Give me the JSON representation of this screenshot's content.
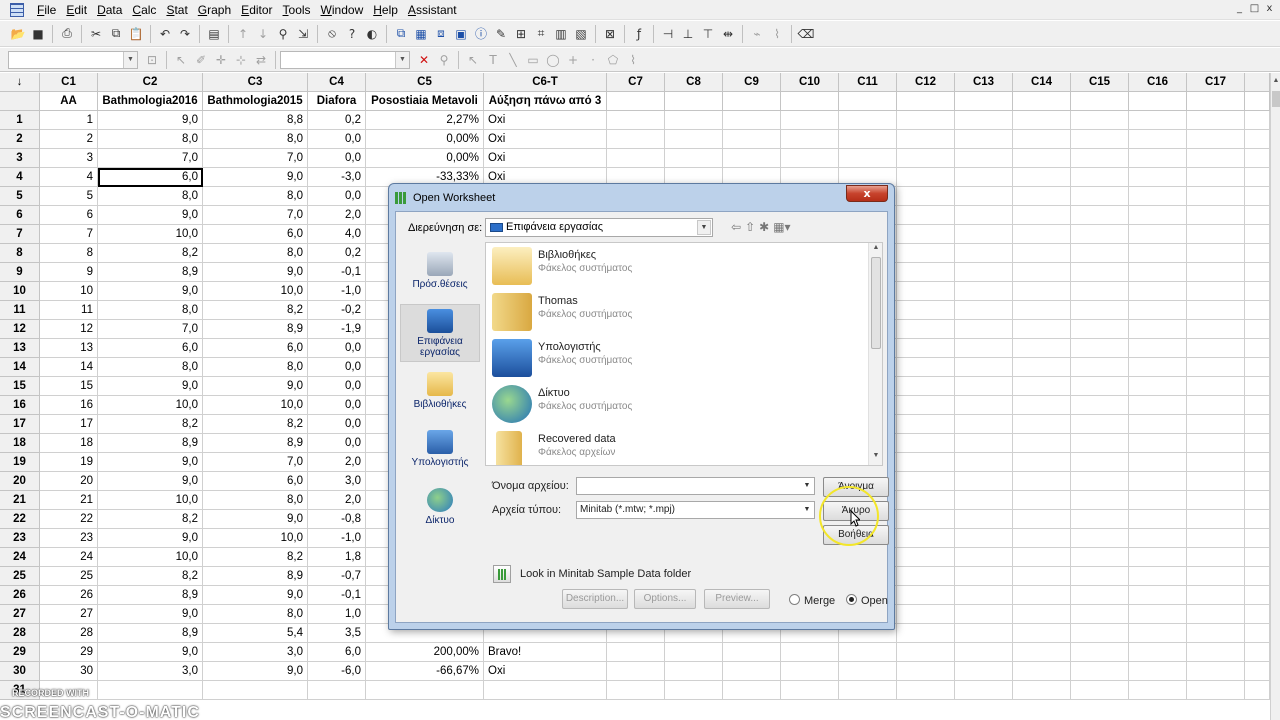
{
  "menu": [
    "File",
    "Edit",
    "Data",
    "Calc",
    "Stat",
    "Graph",
    "Editor",
    "Tools",
    "Window",
    "Help",
    "Assistant"
  ],
  "window_controls": [
    "_",
    "□",
    "x"
  ],
  "column_headers": [
    "C1",
    "C2",
    "C3",
    "C4",
    "C5",
    "C6-T",
    "C7",
    "C8",
    "C9",
    "C10",
    "C11",
    "C12",
    "C13",
    "C14",
    "C15",
    "C16",
    "C17"
  ],
  "column_names": [
    "AA",
    "Bathmologia2016",
    "Bathmologia2015",
    "Diafora",
    "Posostiaia Metavoli",
    "Αύξηση πάνω από 3",
    "",
    "",
    "",
    "",
    "",
    "",
    "",
    "",
    "",
    "",
    ""
  ],
  "corner_label": "↓",
  "rows": [
    [
      "1",
      "1",
      "9,0",
      "8,8",
      "0,2",
      "2,27%",
      "Oxi"
    ],
    [
      "2",
      "2",
      "8,0",
      "8,0",
      "0,0",
      "0,00%",
      "Oxi"
    ],
    [
      "3",
      "3",
      "7,0",
      "7,0",
      "0,0",
      "0,00%",
      "Oxi"
    ],
    [
      "4",
      "4",
      "6,0",
      "9,0",
      "-3,0",
      "-33,33%",
      "Oxi"
    ],
    [
      "5",
      "5",
      "8,0",
      "8,0",
      "0,0",
      "",
      ""
    ],
    [
      "6",
      "6",
      "9,0",
      "7,0",
      "2,0",
      "",
      ""
    ],
    [
      "7",
      "7",
      "10,0",
      "6,0",
      "4,0",
      "",
      ""
    ],
    [
      "8",
      "8",
      "8,2",
      "8,0",
      "0,2",
      "",
      ""
    ],
    [
      "9",
      "9",
      "8,9",
      "9,0",
      "-0,1",
      "",
      ""
    ],
    [
      "10",
      "10",
      "9,0",
      "10,0",
      "-1,0",
      "",
      ""
    ],
    [
      "11",
      "11",
      "8,0",
      "8,2",
      "-0,2",
      "",
      ""
    ],
    [
      "12",
      "12",
      "7,0",
      "8,9",
      "-1,9",
      "",
      ""
    ],
    [
      "13",
      "13",
      "6,0",
      "6,0",
      "0,0",
      "",
      ""
    ],
    [
      "14",
      "14",
      "8,0",
      "8,0",
      "0,0",
      "",
      ""
    ],
    [
      "15",
      "15",
      "9,0",
      "9,0",
      "0,0",
      "",
      ""
    ],
    [
      "16",
      "16",
      "10,0",
      "10,0",
      "0,0",
      "",
      ""
    ],
    [
      "17",
      "17",
      "8,2",
      "8,2",
      "0,0",
      "",
      ""
    ],
    [
      "18",
      "18",
      "8,9",
      "8,9",
      "0,0",
      "",
      ""
    ],
    [
      "19",
      "19",
      "9,0",
      "7,0",
      "2,0",
      "",
      ""
    ],
    [
      "20",
      "20",
      "9,0",
      "6,0",
      "3,0",
      "",
      ""
    ],
    [
      "21",
      "21",
      "10,0",
      "8,0",
      "2,0",
      "",
      ""
    ],
    [
      "22",
      "22",
      "8,2",
      "9,0",
      "-0,8",
      "",
      ""
    ],
    [
      "23",
      "23",
      "9,0",
      "10,0",
      "-1,0",
      "",
      ""
    ],
    [
      "24",
      "24",
      "10,0",
      "8,2",
      "1,8",
      "",
      ""
    ],
    [
      "25",
      "25",
      "8,2",
      "8,9",
      "-0,7",
      "",
      ""
    ],
    [
      "26",
      "26",
      "8,9",
      "9,0",
      "-0,1",
      "",
      ""
    ],
    [
      "27",
      "27",
      "9,0",
      "8,0",
      "1,0",
      "",
      ""
    ],
    [
      "28",
      "28",
      "8,9",
      "5,4",
      "3,5",
      "",
      ""
    ],
    [
      "29",
      "29",
      "9,0",
      "3,0",
      "6,0",
      "200,00%",
      "Bravo!"
    ],
    [
      "30",
      "30",
      "3,0",
      "9,0",
      "-6,0",
      "-66,67%",
      "Oxi"
    ],
    [
      "31",
      "",
      "",
      "",
      "",
      "",
      ""
    ]
  ],
  "dialog": {
    "title": "Open Worksheet",
    "close": "x",
    "look_in_label": "Διερεύνηση σε:",
    "look_in_value": "Επιφάνεια εργασίας",
    "places": [
      {
        "label": "Πρόσ.θέσεις"
      },
      {
        "label": "Επιφάνεια εργασίας"
      },
      {
        "label": "Βιβλιοθήκες"
      },
      {
        "label": "Υπολογιστής"
      },
      {
        "label": "Δίκτυο"
      }
    ],
    "files": [
      {
        "name": "Βιβλιοθήκες",
        "type": "Φάκελος συστήματος"
      },
      {
        "name": "Thomas",
        "type": "Φάκελος συστήματος"
      },
      {
        "name": "Υπολογιστής",
        "type": "Φάκελος συστήματος"
      },
      {
        "name": "Δίκτυο",
        "type": "Φάκελος συστήματος"
      },
      {
        "name": "Recovered data",
        "type": "Φάκελος αρχείων"
      }
    ],
    "filename_label": "Όνομα αρχείου:",
    "filename_value": "",
    "filetype_label": "Αρχεία τύπου:",
    "filetype_value": "Minitab (*.mtw; *.mpj)",
    "open_button": "Άνοιγμα",
    "cancel_button": "Άκυρο",
    "help_button": "Βοήθεια",
    "sample_label": "Look in Minitab Sample Data folder",
    "description_button": "Description...",
    "options_button": "Options...",
    "preview_button": "Preview...",
    "merge_label": "Merge",
    "open_label": "Open",
    "selected_mode": "Open"
  },
  "watermark": {
    "line1": "RECORDED WITH",
    "line2": "SCREENCAST-O-MATIC"
  }
}
